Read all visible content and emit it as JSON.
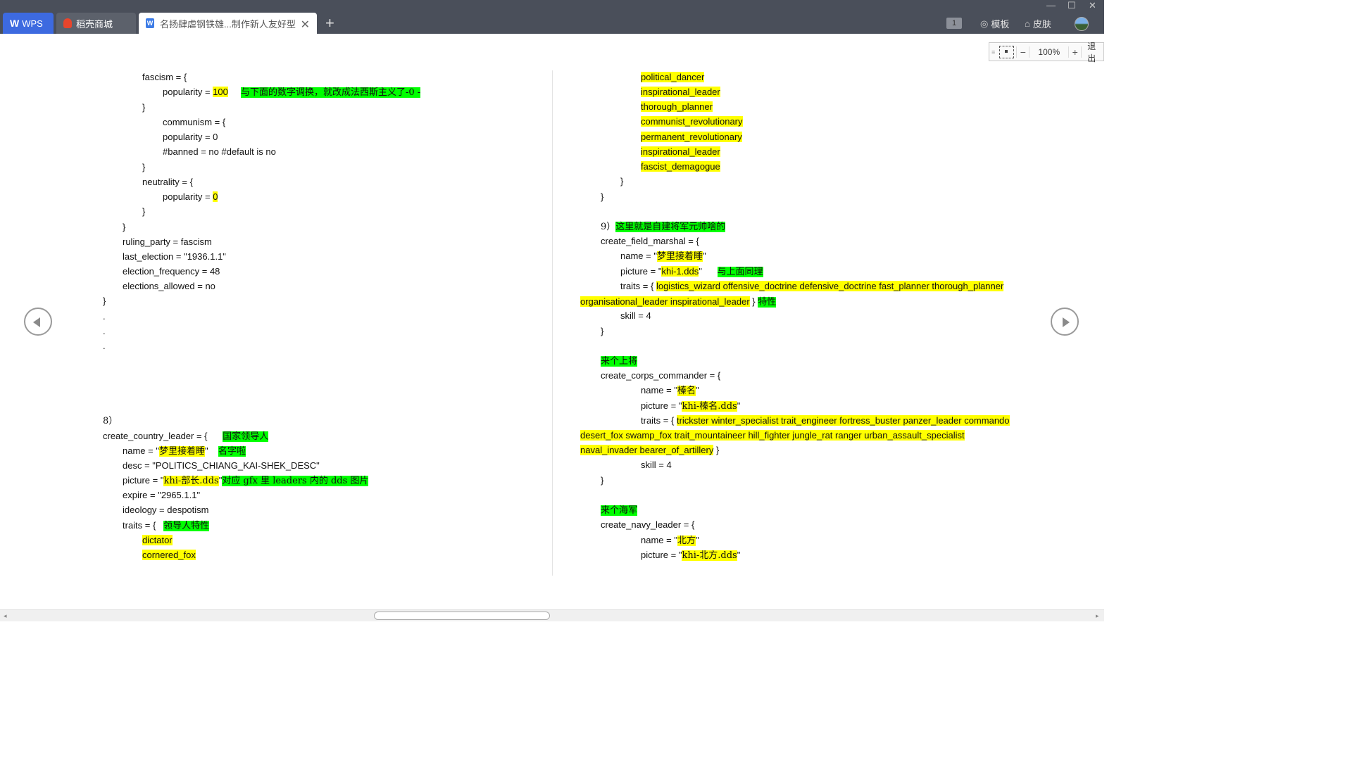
{
  "tabs": {
    "wps": "WPS",
    "store": "稻壳商城",
    "doc": "名扬肆虐钢铁雄...制作新人友好型"
  },
  "toolbar": {
    "page_count": "1",
    "template": "模板",
    "skin": "皮肤",
    "zoom": "100%",
    "exit": "退出"
  },
  "left_lines": [
    [
      "fascism = {"
    ],
    [
      "popularity = ",
      [
        "100",
        "y"
      ],
      "     ",
      [
        "与下面的数字调换，就改成法西斯主义了-0 -",
        "g"
      ]
    ],
    [
      "}"
    ],
    [
      "communism = {"
    ],
    [
      "popularity = 0"
    ],
    [
      "#banned = no #default is no"
    ],
    [
      "}"
    ],
    [
      "neutrality = {"
    ],
    [
      "popularity = ",
      [
        "0",
        "y"
      ]
    ],
    [
      "}"
    ],
    [
      "}"
    ],
    [
      "ruling_party = fascism"
    ],
    [
      "last_election = \"1936.1.1\""
    ],
    [
      "election_frequency = 48"
    ],
    [
      "elections_allowed = no"
    ],
    [
      "}"
    ],
    [
      "."
    ],
    [
      "."
    ],
    [
      "."
    ],
    [
      "8）"
    ],
    [
      "create_country_leader = {      ",
      [
        "国家领导人",
        "g"
      ]
    ],
    [
      "name = \"",
      [
        "梦里接着睡",
        "y"
      ],
      "\"    ",
      [
        "名字啦",
        "g"
      ]
    ],
    [
      "desc = \"POLITICS_CHIANG_KAI-SHEK_DESC\""
    ],
    [
      "picture = \"",
      [
        "khi-部长.dds",
        "y"
      ],
      "\"",
      [
        "对应 gfx 里 leaders 内的 dds 图片",
        "g"
      ]
    ],
    [
      "expire = \"2965.1.1\""
    ],
    [
      "ideology = despotism"
    ],
    [
      "traits = {   ",
      [
        "领导人特性",
        "g"
      ]
    ],
    [
      [
        "dictator",
        "y"
      ]
    ],
    [
      [
        "cornered_fox",
        "y"
      ]
    ]
  ],
  "right_lines": [
    [
      [
        "political_dancer",
        "y"
      ]
    ],
    [
      [
        "inspirational_leader",
        "y"
      ]
    ],
    [
      [
        "thorough_planner",
        "y"
      ]
    ],
    [
      [
        "communist_revolutionary",
        "y"
      ]
    ],
    [
      [
        "permanent_revolutionary",
        "y"
      ]
    ],
    [
      [
        "inspirational_leader",
        "y"
      ]
    ],
    [
      [
        "fascist_demagogue",
        "y"
      ]
    ],
    [
      "}"
    ],
    [
      "}"
    ],
    [
      "9）",
      [
        "这里就是自建将军元帅啥的",
        "g"
      ]
    ],
    [
      "create_field_marshal = {"
    ],
    [
      "name = \"",
      [
        "梦里接着睡",
        "y"
      ],
      "\""
    ],
    [
      "picture = \"",
      [
        "khi-1.dds",
        "y"
      ],
      "\"      ",
      [
        "与上面同理",
        "g"
      ]
    ],
    [
      "traits = { ",
      [
        "logistics_wizard offensive_doctrine defensive_doctrine fast_planner thorough_planner",
        "y"
      ]
    ],
    [
      [
        "organisational_leader inspirational_leader",
        "y"
      ],
      " } ",
      [
        "特性",
        "g"
      ]
    ],
    [
      "skill = 4"
    ],
    [
      "}"
    ],
    [
      [
        "来个上将",
        "g"
      ]
    ],
    [
      "create_corps_commander = {"
    ],
    [
      "name = \"",
      [
        "榛名",
        "y"
      ],
      "\""
    ],
    [
      "picture = \"",
      [
        "khi-榛名.dds",
        "y"
      ],
      "\""
    ],
    [
      "traits = { ",
      [
        "trickster winter_specialist trait_engineer fortress_buster panzer_leader commando",
        "y"
      ]
    ],
    [
      [
        "desert_fox swamp_fox trait_mountaineer hill_fighter jungle_rat ranger urban_assault_specialist",
        "y"
      ]
    ],
    [
      [
        "naval_invader bearer_of_artillery",
        "y"
      ],
      " }"
    ],
    [
      "skill = 4"
    ],
    [
      "}"
    ],
    [
      [
        "来个海军",
        "g"
      ]
    ],
    [
      "create_navy_leader = {"
    ],
    [
      "name = \"",
      [
        "北方",
        "y"
      ],
      "\""
    ],
    [
      "picture = \"",
      [
        "khi-北方.dds",
        "y"
      ],
      "\""
    ]
  ]
}
